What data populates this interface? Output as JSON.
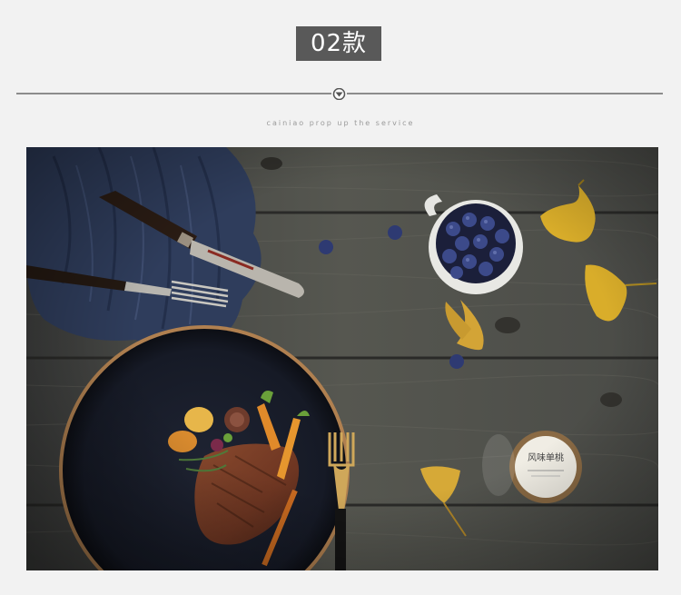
{
  "header": {
    "badge_label": "02款",
    "tagline": "cainiao prop up the service"
  },
  "photo": {
    "subject": "flat-lay",
    "elements": [
      "wooden-table",
      "blue-linen-napkin",
      "steak-knife",
      "fork",
      "cup-of-blueberries",
      "ginkgo-leaves",
      "blueberries",
      "dark-plate",
      "steak",
      "roasted-vegetables",
      "gold-fork",
      "glass-jar"
    ],
    "jar_label": "风味单桃"
  },
  "colors": {
    "badge_bg": "#595959",
    "page_bg": "#f2f2f2",
    "divider": "#8c8c8c"
  }
}
